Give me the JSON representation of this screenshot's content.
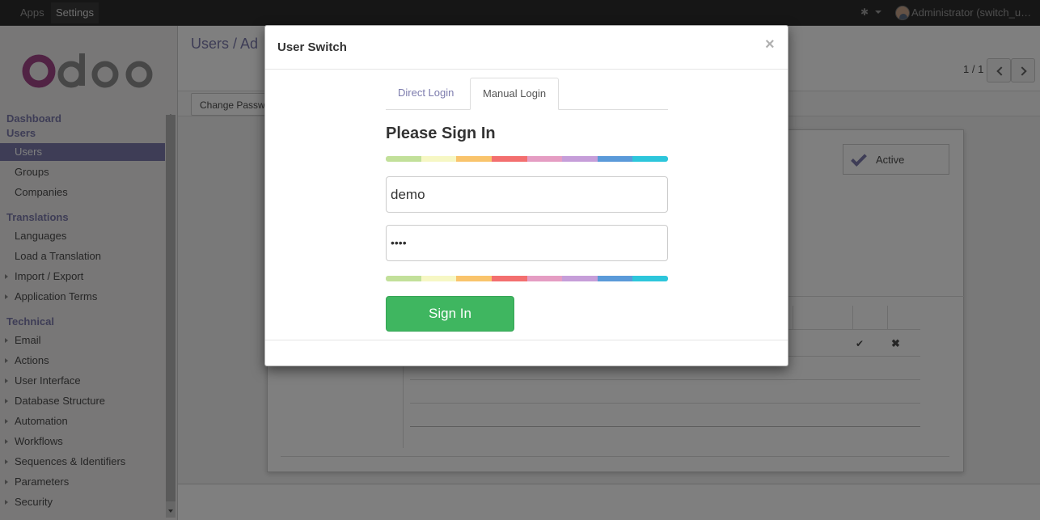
{
  "navbar": {
    "apps_label": "Apps",
    "settings_label": "Settings",
    "user_label": "Administrator (switch_u…"
  },
  "sidebar": {
    "sections": [
      {
        "title": "Dashboard"
      },
      {
        "title": "Users"
      },
      {
        "title": "Translations"
      },
      {
        "title": "Technical"
      }
    ],
    "users_items": [
      "Users",
      "Groups",
      "Companies"
    ],
    "translations_items": [
      "Languages",
      "Load a Translation",
      "Import / Export",
      "Application Terms"
    ],
    "technical_items": [
      "Email",
      "Actions",
      "User Interface",
      "Database Structure",
      "Automation",
      "Workflows",
      "Sequences & Identifiers",
      "Parameters",
      "Security"
    ]
  },
  "main": {
    "breadcrumb": "Users /  Ad",
    "pager": "1 / 1",
    "change_password_label": "Change Passw",
    "active_label": "Active"
  },
  "modal": {
    "title": "User Switch",
    "close_glyph": "×",
    "tabs": [
      "Direct Login",
      "Manual Login"
    ],
    "active_tab": "Manual Login",
    "heading": "Please Sign In",
    "login_value": "demo",
    "password_value": "••••",
    "submit_label": "Sign In"
  },
  "colors": {
    "accent": "#7c7bad",
    "button_green": "#3fb660",
    "rainbow": [
      "#c2e09a",
      "#f6f7c4",
      "#f9c46c",
      "#f36f6f",
      "#e59dc3",
      "#c69ed9",
      "#5b9ad9",
      "#2dc6db"
    ]
  },
  "icons": [
    "bug-icon",
    "avatar",
    "check-icon",
    "cross-icon",
    "chevron-left-icon",
    "chevron-right-icon"
  ]
}
